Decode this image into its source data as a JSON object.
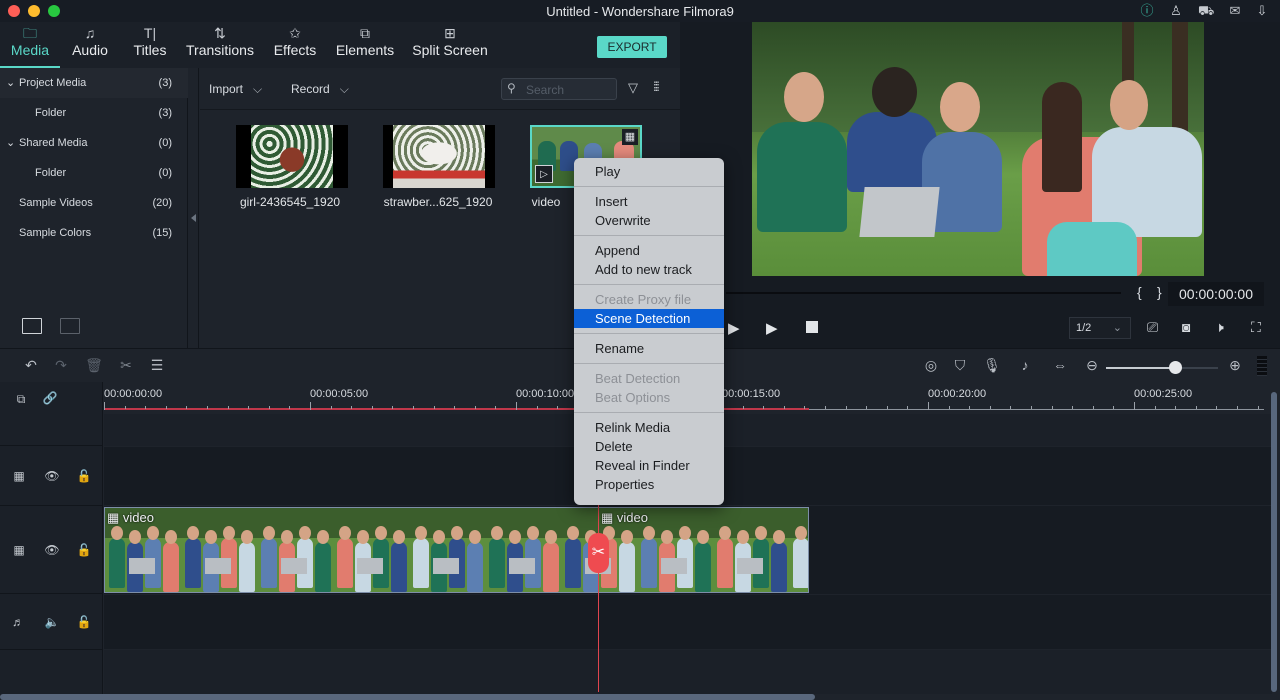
{
  "window": {
    "title": "Untitled - Wondershare Filmora9",
    "top_icons": [
      "info-icon",
      "account-icon",
      "cart-icon",
      "mail-icon",
      "download-icon"
    ]
  },
  "nav": {
    "tabs": [
      {
        "label": "Media",
        "icon": "folder-icon",
        "active": true
      },
      {
        "label": "Audio",
        "icon": "music-note-icon"
      },
      {
        "label": "Titles",
        "icon": "titles-icon"
      },
      {
        "label": "Transitions",
        "icon": "transitions-icon"
      },
      {
        "label": "Effects",
        "icon": "effects-icon"
      },
      {
        "label": "Elements",
        "icon": "elements-icon"
      },
      {
        "label": "Split Screen",
        "icon": "split-screen-icon"
      }
    ],
    "export_label": "EXPORT"
  },
  "sidebar": {
    "items": [
      {
        "label": "Project Media",
        "count": "(3)",
        "expanded": true
      },
      {
        "label": "Folder",
        "count": "(3)"
      },
      {
        "label": "Shared Media",
        "count": "(0)",
        "expanded": true
      },
      {
        "label": "Folder",
        "count": "(0)"
      },
      {
        "label": "Sample Videos",
        "count": "(20)"
      },
      {
        "label": "Sample Colors",
        "count": "(15)"
      }
    ]
  },
  "mediabar": {
    "import_label": "Import",
    "record_label": "Record",
    "search_placeholder": "Search"
  },
  "media": {
    "items": [
      {
        "name": "girl-2436545_1920"
      },
      {
        "name": "strawber...625_1920"
      },
      {
        "name": "video",
        "selected": true
      }
    ]
  },
  "context_menu": {
    "groups": [
      [
        {
          "label": "Play"
        }
      ],
      [
        {
          "label": "Insert"
        },
        {
          "label": "Overwrite"
        }
      ],
      [
        {
          "label": "Append"
        },
        {
          "label": "Add to new track"
        }
      ],
      [
        {
          "label": "Create Proxy file",
          "disabled": true
        },
        {
          "label": "Scene Detection",
          "highlighted": true
        }
      ],
      [
        {
          "label": "Rename"
        }
      ],
      [
        {
          "label": "Beat Detection",
          "disabled": true
        },
        {
          "label": "Beat Options",
          "disabled": true
        }
      ],
      [
        {
          "label": "Relink Media"
        },
        {
          "label": "Delete"
        },
        {
          "label": "Reveal in Finder"
        },
        {
          "label": "Properties"
        }
      ]
    ]
  },
  "player": {
    "timecode": "00:00:00:00",
    "quality": "1/2",
    "mark_in": "{",
    "mark_out": "}"
  },
  "timeline": {
    "ruler": [
      "00:00:00:00",
      "00:00:05:00",
      "00:00:10:00",
      "00:00:15:00",
      "00:00:20:00",
      "00:00:25:00"
    ],
    "clips": [
      {
        "label": "video"
      },
      {
        "label": "video"
      }
    ],
    "zoom_level": 0.62
  },
  "colors": {
    "accent": "#5ad8c8",
    "highlight": "#0c60d6",
    "playhead": "#e0454f"
  }
}
